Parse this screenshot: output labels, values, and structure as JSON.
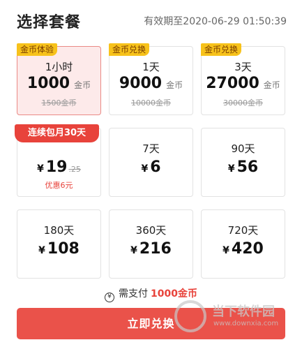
{
  "header": {
    "title": "选择套餐",
    "expiry": "有效期至2020-06-29 01:50:39"
  },
  "coin_packages": [
    {
      "tag": "金币体验",
      "duration": "1小时",
      "amount": "1000",
      "unit": "金币",
      "original": "1500金币"
    },
    {
      "tag": "金币兑换",
      "duration": "1天",
      "amount": "9000",
      "unit": "金币",
      "original": "10000金币"
    },
    {
      "tag": "金币兑换",
      "duration": "3天",
      "amount": "27000",
      "unit": "金币",
      "original": "30000金币"
    }
  ],
  "vip_packages": [
    {
      "ribbon": "连续包月30天",
      "currency": "¥",
      "price": "19",
      "decimal": ".25",
      "discount": "优惠6元"
    },
    {
      "duration": "7天",
      "currency": "¥",
      "price": "6"
    },
    {
      "duration": "90天",
      "currency": "¥",
      "price": "56"
    },
    {
      "duration": "180天",
      "currency": "¥",
      "price": "108"
    },
    {
      "duration": "360天",
      "currency": "¥",
      "price": "216"
    },
    {
      "duration": "720天",
      "currency": "¥",
      "price": "420"
    }
  ],
  "payment": {
    "icon": "yen-coin-icon",
    "label": "需支付",
    "amount": "1000金币"
  },
  "confirm_button": {
    "label": "立即兑换"
  },
  "watermark": {
    "text": "当下软件园",
    "url": "www.downxia.com"
  },
  "colors": {
    "accent": "#e8433b",
    "tag": "#f7c21b",
    "selected_bg": "#fdeaea"
  }
}
